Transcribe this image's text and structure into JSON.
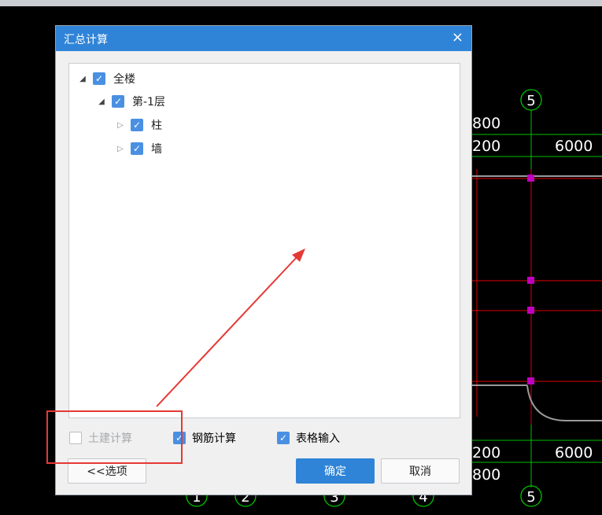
{
  "dialog": {
    "title": "汇总计算",
    "close_glyph": "×",
    "tree": [
      {
        "label": "全楼",
        "checked": true,
        "expanded": true
      },
      {
        "label": "第-1层",
        "checked": true,
        "expanded": true
      },
      {
        "label": "柱",
        "checked": true,
        "expanded": false
      },
      {
        "label": "墙",
        "checked": true,
        "expanded": false
      }
    ],
    "options": {
      "civil": {
        "label": "土建计算",
        "checked": false,
        "disabled": true
      },
      "rebar": {
        "label": "钢筋计算",
        "checked": true
      },
      "table": {
        "label": "表格输入",
        "checked": true
      }
    },
    "buttons": {
      "options": "<<选项",
      "ok": "确定",
      "cancel": "取消"
    }
  },
  "cad": {
    "dim_top_1": "800",
    "dim_top_2": "200",
    "dim_top_3": "6000",
    "dim_bottom_1": "200",
    "dim_bottom_2": "6000",
    "dim_bottom_3": "800",
    "axis_top": "5",
    "axis_bottom": [
      "1",
      "2",
      "3",
      "4",
      "5"
    ]
  },
  "colors": {
    "title_bar": "#2f84d8",
    "highlight_box": "#e53935",
    "annotation_arrow": "#e53935"
  }
}
